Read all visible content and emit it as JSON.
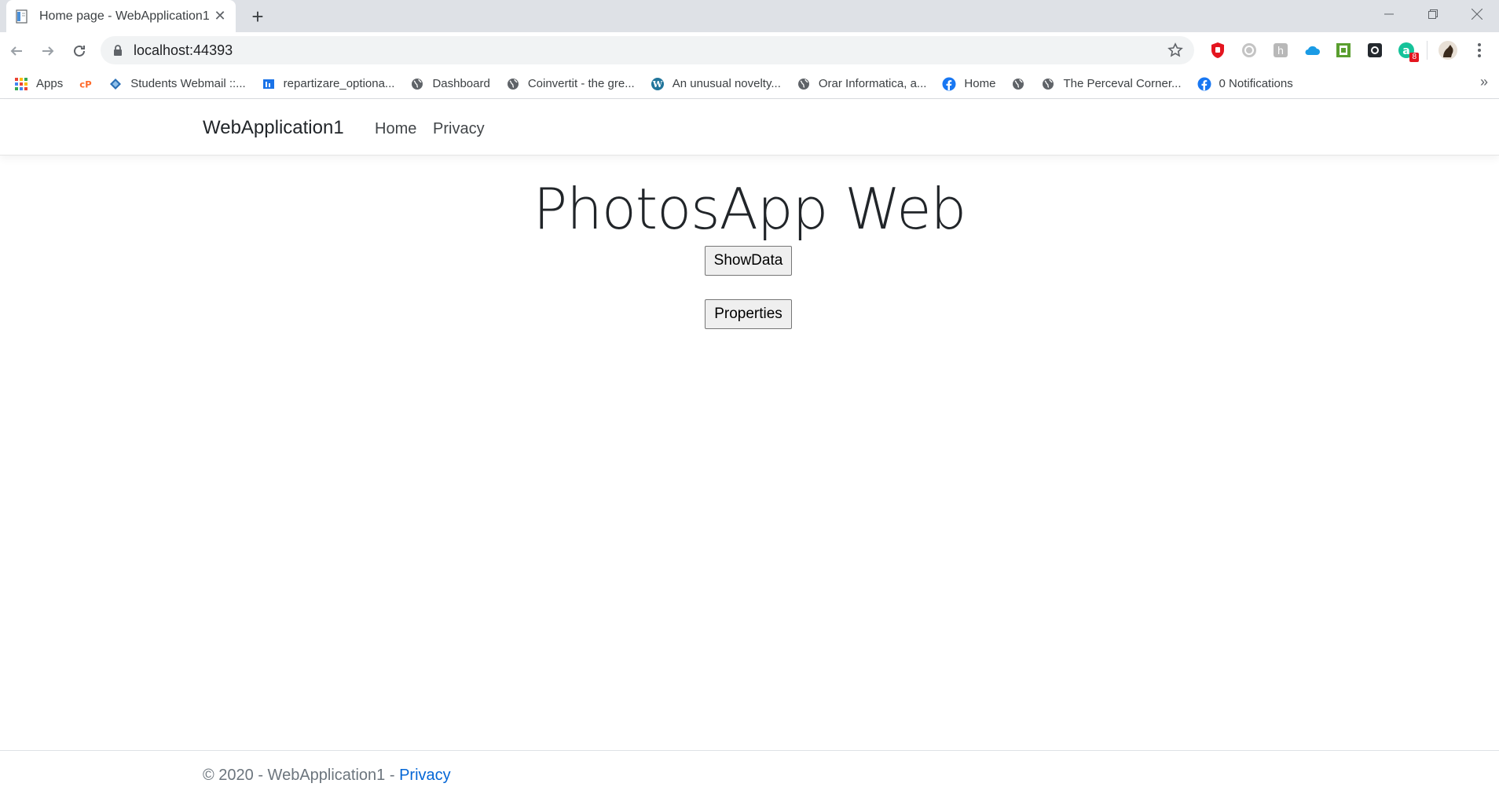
{
  "browser": {
    "tab": {
      "title": "Home page - WebApplication1"
    },
    "address": {
      "url": "localhost:44393"
    },
    "bookmarks": [
      {
        "label": "Apps",
        "icon": "apps-grid-icon"
      },
      {
        "label": "",
        "icon": "cpanel-icon"
      },
      {
        "label": "Students Webmail ::...",
        "icon": "webmail-icon"
      },
      {
        "label": "repartizare_optiona...",
        "icon": "sheet-icon"
      },
      {
        "label": "Dashboard",
        "icon": "globe-icon"
      },
      {
        "label": "Coinvertit - the gre...",
        "icon": "globe-icon"
      },
      {
        "label": "An unusual novelty...",
        "icon": "wordpress-icon"
      },
      {
        "label": "Orar Informatica, a...",
        "icon": "globe-icon"
      },
      {
        "label": "Home",
        "icon": "facebook-icon"
      },
      {
        "label": "",
        "icon": "globe-icon"
      },
      {
        "label": "The Perceval Corner...",
        "icon": "globe-icon"
      },
      {
        "label": "0 Notifications",
        "icon": "facebook-icon"
      }
    ],
    "extension_badge": "8",
    "colors": {
      "facebook": "#1877f2",
      "opera_red": "#e4151f",
      "grammarly_green": "#15c39a"
    }
  },
  "site": {
    "brand": "WebApplication1",
    "nav": {
      "home": "Home",
      "privacy": "Privacy"
    },
    "heading": "PhotosApp Web",
    "buttons": {
      "show_data": "ShowData",
      "properties": "Properties"
    },
    "footer": {
      "text": "© 2020 - WebApplication1 - ",
      "link": "Privacy"
    }
  }
}
